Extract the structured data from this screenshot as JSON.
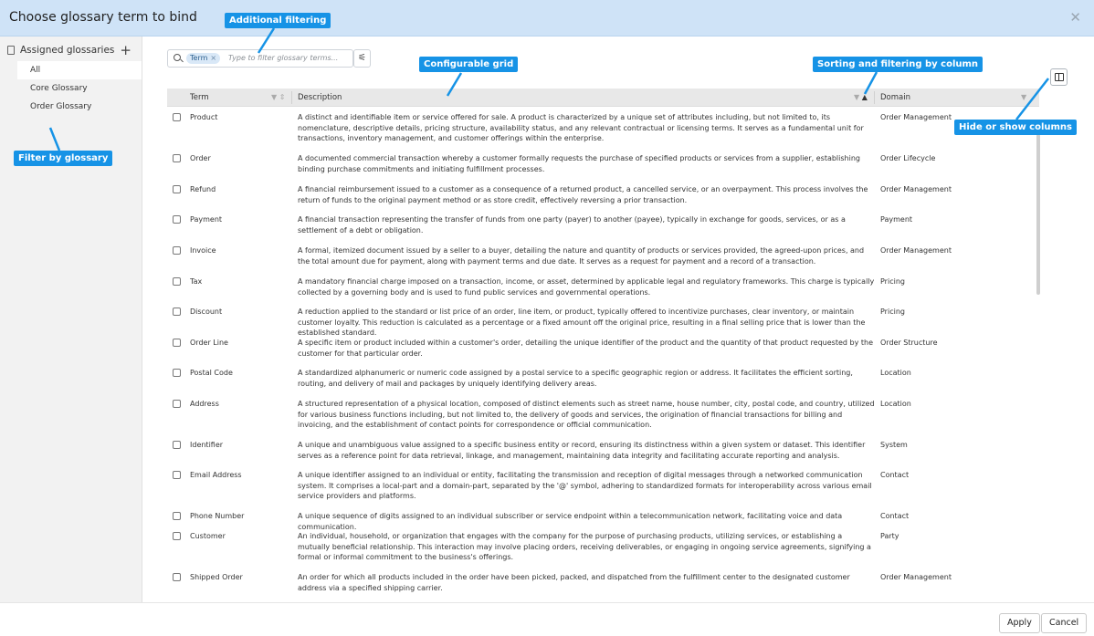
{
  "dialog": {
    "title": "Choose glossary term to bind",
    "close_label": "✕"
  },
  "sidebar": {
    "heading": "Assigned glossaries",
    "add_label": "+",
    "items": [
      {
        "label": "All"
      },
      {
        "label": "Core Glossary"
      },
      {
        "label": "Order Glossary"
      }
    ]
  },
  "search": {
    "chip_label": "Term",
    "chip_remove": "×",
    "placeholder": "Type to filter glossary terms...",
    "filter_icon": "⚟"
  },
  "grid": {
    "columns": {
      "term": "Term",
      "description": "Description",
      "domain": "Domain"
    },
    "rows": [
      {
        "term": "Product",
        "description": "A distinct and identifiable item or service offered for sale. A product is characterized by a unique set of attributes including, but not limited to, its nomenclature, descriptive details, pricing structure, availability status, and any relevant contractual or licensing terms. It serves as a fundamental unit for transactions, inventory management, and customer offerings within the enterprise.",
        "domain": "Order Management"
      },
      {
        "term": "Order",
        "description": "A documented commercial transaction whereby a customer formally requests the purchase of specified products or services from a supplier, establishing binding purchase commitments and initiating fulfillment processes.",
        "domain": "Order Lifecycle"
      },
      {
        "term": "Refund",
        "description": "A financial reimbursement issued to a customer as a consequence of a returned product, a cancelled service, or an overpayment. This process involves the return of funds to the original payment method or as store credit, effectively reversing a prior transaction.",
        "domain": "Order Management"
      },
      {
        "term": "Payment",
        "description": "A financial transaction representing the transfer of funds from one party (payer) to another (payee), typically in exchange for goods, services, or as a settlement of a debt or obligation.",
        "domain": "Payment"
      },
      {
        "term": "Invoice",
        "description": "A formal, itemized document issued by a seller to a buyer, detailing the nature and quantity of products or services provided, the agreed-upon prices, and the total amount due for payment, along with payment terms and due date. It serves as a request for payment and a record of a transaction.",
        "domain": "Order Management"
      },
      {
        "term": "Tax",
        "description": "A mandatory financial charge imposed on a transaction, income, or asset, determined by applicable legal and regulatory frameworks. This charge is typically collected by a governing body and is used to fund public services and governmental operations.",
        "domain": "Pricing"
      },
      {
        "term": "Discount",
        "description": "A reduction applied to the standard or list price of an order, line item, or product, typically offered to incentivize purchases, clear inventory, or maintain customer loyalty. This reduction is calculated as a percentage or a fixed amount off the original price, resulting in a final selling price that is lower than the established standard.",
        "domain": "Pricing"
      },
      {
        "term": "Order Line",
        "description": "A specific item or product included within a customer's order, detailing the unique identifier of the product and the quantity of that product requested by the customer for that particular order.",
        "domain": "Order Structure"
      },
      {
        "term": "Postal Code",
        "description": "A standardized alphanumeric or numeric code assigned by a postal service to a specific geographic region or address. It facilitates the efficient sorting, routing, and delivery of mail and packages by uniquely identifying delivery areas.",
        "domain": "Location"
      },
      {
        "term": "Address",
        "description": "A structured representation of a physical location, composed of distinct elements such as street name, house number, city, postal code, and country, utilized for various business functions including, but not limited to, the delivery of goods and services, the origination of financial transactions for billing and invoicing, and the establishment of contact points for correspondence or official communication.",
        "domain": "Location"
      },
      {
        "term": "Identifier",
        "description": "A unique and unambiguous value assigned to a specific business entity or record, ensuring its distinctness within a given system or dataset. This identifier serves as a reference point for data retrieval, linkage, and management, maintaining data integrity and facilitating accurate reporting and analysis.",
        "domain": "System"
      },
      {
        "term": "Email Address",
        "description": "A unique identifier assigned to an individual or entity, facilitating the transmission and reception of digital messages through a networked communication system. It comprises a local-part and a domain-part, separated by the '@' symbol, adhering to standardized formats for interoperability across various email service providers and platforms.",
        "domain": "Contact"
      },
      {
        "term": "Phone Number",
        "description": "A unique sequence of digits assigned to an individual subscriber or service endpoint within a telecommunication network, facilitating voice and data communication.",
        "domain": "Contact"
      },
      {
        "term": "Customer",
        "description": "An individual, household, or organization that engages with the company for the purpose of purchasing products, utilizing services, or establishing a mutually beneficial relationship. This interaction may involve placing orders, receiving deliverables, or engaging in ongoing service agreements, signifying a formal or informal commitment to the business's offerings.",
        "domain": "Party"
      },
      {
        "term": "Shipped Order",
        "description": "An order for which all products included in the order have been picked, packed, and dispatched from the fulfillment center to the designated customer address via a specified shipping carrier.",
        "domain": "Order Management"
      }
    ]
  },
  "footer": {
    "apply_label": "Apply",
    "cancel_label": "Cancel"
  },
  "callouts": {
    "additional_filtering": "Additional filtering",
    "configurable_grid": "Configurable grid",
    "sorting_filtering": "Sorting and filtering by column",
    "hide_show_columns": "Hide or show columns",
    "filter_by_glossary": "Filter by glossary"
  },
  "colors": {
    "header_bg": "#cfe3f7",
    "callout_bg": "#1693e6",
    "sidebar_bg": "#f2f2f2",
    "grid_header_bg": "#e8e8e8"
  }
}
